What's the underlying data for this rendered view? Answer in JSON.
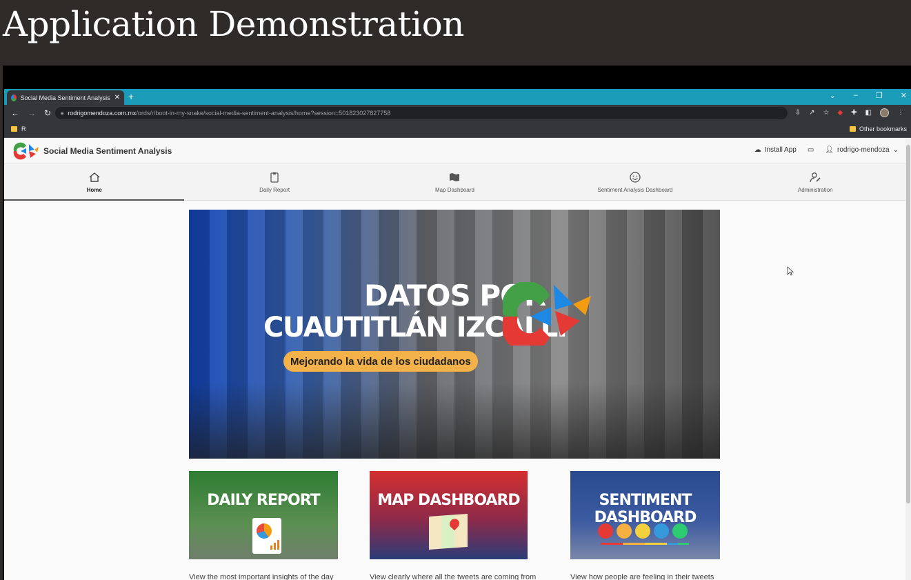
{
  "slide": {
    "title": "Application Demonstration"
  },
  "browser": {
    "tab_title": "Social Media Sentiment Analysis",
    "tab_close": "✕",
    "new_tab": "+",
    "window_controls": [
      "⌄",
      "–",
      "❐",
      "✕"
    ],
    "nav_back": "←",
    "nav_forward": "→",
    "nav_reload": "↻",
    "url_host": "rodrigomendoza.com.mx",
    "url_path": "/ords/r/boot-in-my-snake/social-media-sentiment-analysis/home?session=501823027827758",
    "bookmark_left": "R",
    "bookmark_right": "Other bookmarks"
  },
  "app": {
    "name": "Social Media Sentiment Analysis",
    "install_label": "Install App",
    "user": "rodrigo-mendoza",
    "nav": [
      {
        "label": "Home",
        "icon": "home-icon"
      },
      {
        "label": "Daily Report",
        "icon": "clipboard-icon"
      },
      {
        "label": "Map Dashboard",
        "icon": "map-icon"
      },
      {
        "label": "Sentiment Analysis Dashboard",
        "icon": "smiley-icon"
      },
      {
        "label": "Administration",
        "icon": "user-wrench-icon"
      }
    ],
    "active_nav": "Home"
  },
  "hero": {
    "line1": "DATOS POR",
    "line2": "CUAUTITLÁN IZCALLI",
    "tagline": "Mejorando la vida de los ciudadanos"
  },
  "cards": [
    {
      "title": "DAILY REPORT",
      "desc": "View the most important insights of the day"
    },
    {
      "title": "MAP DASHBOARD",
      "desc": "View clearly where all the tweets are coming from"
    },
    {
      "title": "SENTIMENT DASHBOARD",
      "desc": "View how people are feeling in their tweets"
    }
  ],
  "colors": {
    "tabbar": "#1a9bb8",
    "accent_orange": "#f3b14a",
    "emoji_colors": [
      "#e53935",
      "#f5b041",
      "#f4d03f",
      "#3498db",
      "#2ecc71"
    ]
  }
}
